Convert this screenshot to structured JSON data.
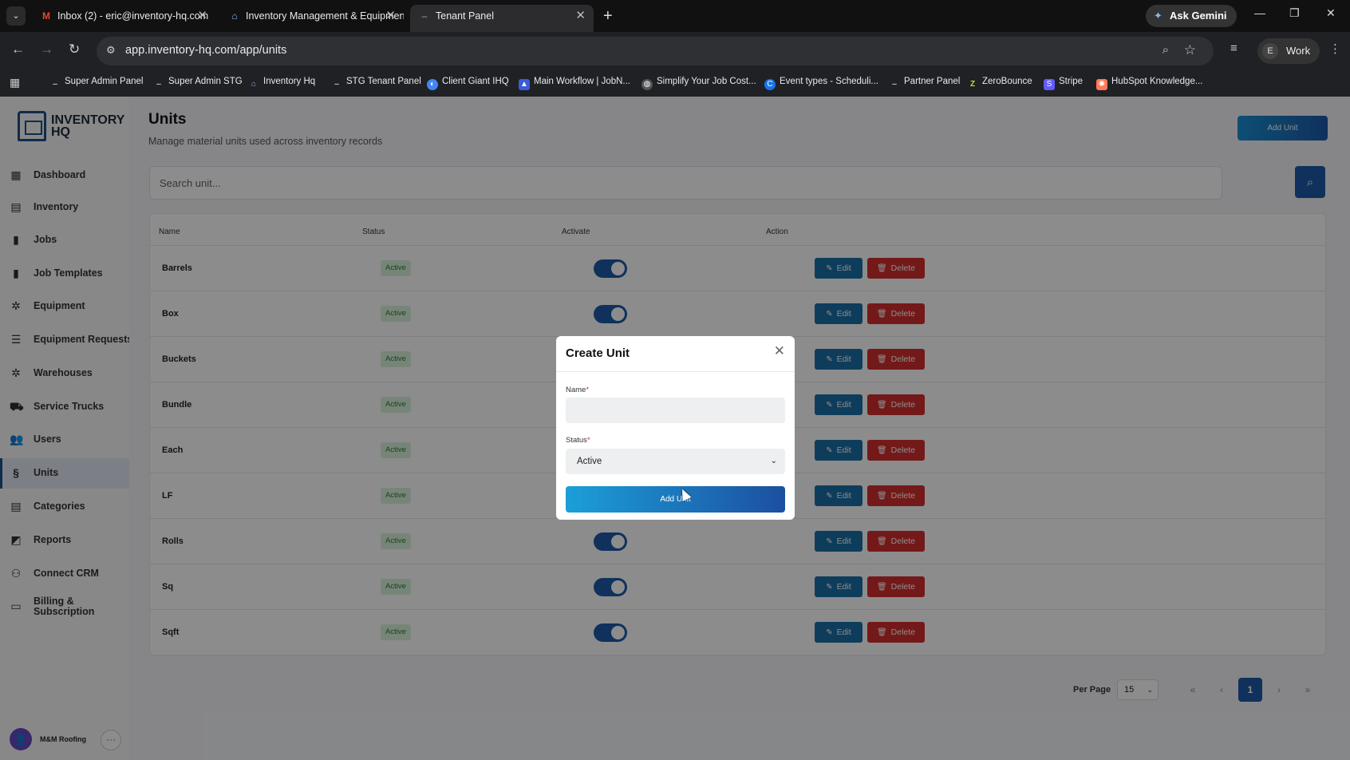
{
  "browser": {
    "tabs": [
      {
        "title": "Inbox (2) - eric@inventory-hq.com",
        "icon": "gmail-icon"
      },
      {
        "title": "Inventory Management & Equipment",
        "icon": "inventory-hq-icon"
      },
      {
        "title": "Tenant Panel",
        "icon": "dash-icon",
        "active": true
      }
    ],
    "ask_gemini": "Ask Gemini",
    "url": "app.inventory-hq.com/app/units",
    "profile_initial": "E",
    "profile_name": "Work",
    "bookmarks": [
      "Super Admin Panel",
      "Super Admin STG",
      "Inventory Hq",
      "STG Tenant Panel",
      "Client Giant IHQ",
      "Main Workflow | JobN...",
      "Simplify Your Job Cost...",
      "Event types - Scheduli...",
      "Partner Panel",
      "ZeroBounce",
      "Stripe",
      "HubSpot Knowledge..."
    ]
  },
  "brand": {
    "line1": "INVENTORY",
    "line2": "HQ",
    "color": "#1f4f8a"
  },
  "sidebar": {
    "items": [
      {
        "label": "Dashboard",
        "icon": "dashboard-icon"
      },
      {
        "label": "Inventory",
        "icon": "boxes-icon"
      },
      {
        "label": "Jobs",
        "icon": "briefcase-icon"
      },
      {
        "label": "Job Templates",
        "icon": "template-icon"
      },
      {
        "label": "Equipment",
        "icon": "wrench-icon"
      },
      {
        "label": "Equipment Requests",
        "icon": "list-icon"
      },
      {
        "label": "Warehouses",
        "icon": "warehouse-icon"
      },
      {
        "label": "Service Trucks",
        "icon": "truck-icon"
      },
      {
        "label": "Users",
        "icon": "users-icon"
      },
      {
        "label": "Units",
        "icon": "units-icon",
        "active": true
      },
      {
        "label": "Categories",
        "icon": "categories-icon"
      },
      {
        "label": "Reports",
        "icon": "reports-icon"
      },
      {
        "label": "Connect CRM",
        "icon": "crm-icon"
      },
      {
        "label": "Billing &",
        "label2": "Subscription",
        "icon": "card-icon"
      }
    ],
    "user": {
      "name": "M&M Roofing",
      "more": "···"
    }
  },
  "page": {
    "title": "Units",
    "subtitle": "Manage material units used across inventory records",
    "add_button": "Add Unit",
    "search_placeholder": "Search unit..."
  },
  "table": {
    "headers": {
      "name": "Name",
      "status": "Status",
      "activate": "Activate",
      "action": "Action"
    },
    "rows": [
      {
        "name": "Barrels",
        "status": "Active"
      },
      {
        "name": "Box",
        "status": "Active"
      },
      {
        "name": "Buckets",
        "status": "Active"
      },
      {
        "name": "Bundle",
        "status": "Active"
      },
      {
        "name": "Each",
        "status": "Active"
      },
      {
        "name": "LF",
        "status": "Active"
      },
      {
        "name": "Rolls",
        "status": "Active"
      },
      {
        "name": "Sq",
        "status": "Active"
      },
      {
        "name": "Sqft",
        "status": "Active"
      }
    ],
    "edit_label": "Edit",
    "delete_label": "Delete"
  },
  "pagination": {
    "per_page_label": "Per Page",
    "per_page_value": "15",
    "current_page": "1"
  },
  "modal": {
    "title": "Create Unit",
    "name_label": "Name",
    "status_label": "Status",
    "status_value": "Active",
    "submit_label": "Add Unit",
    "required_mark": "*"
  },
  "colors": {
    "primary": "#1c5aa8",
    "danger": "#d32f2f",
    "success_bg": "#d9f2dc"
  }
}
